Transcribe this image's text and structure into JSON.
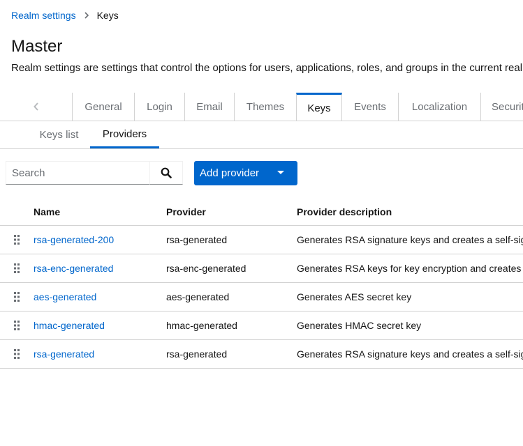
{
  "breadcrumb": {
    "parent": "Realm settings",
    "current": "Keys"
  },
  "page": {
    "title": "Master",
    "description": "Realm settings are settings that control the options for users, applications, roles, and groups in the current realm."
  },
  "tabs": [
    {
      "label": "General"
    },
    {
      "label": "Login"
    },
    {
      "label": "Email"
    },
    {
      "label": "Themes"
    },
    {
      "label": "Keys",
      "active": true
    },
    {
      "label": "Events"
    },
    {
      "label": "Localization"
    },
    {
      "label": "Security defenses"
    }
  ],
  "subtabs": [
    {
      "label": "Keys list"
    },
    {
      "label": "Providers",
      "active": true
    }
  ],
  "toolbar": {
    "search_placeholder": "Search",
    "add_provider_label": "Add provider"
  },
  "table": {
    "columns": [
      "Name",
      "Provider",
      "Provider description"
    ],
    "rows": [
      {
        "name": "rsa-generated-200",
        "provider": "rsa-generated",
        "description": "Generates RSA signature keys and creates a self-signed certificate"
      },
      {
        "name": "rsa-enc-generated",
        "provider": "rsa-enc-generated",
        "description": "Generates RSA keys for key encryption and creates a self-signed certificate"
      },
      {
        "name": "aes-generated",
        "provider": "aes-generated",
        "description": "Generates AES secret key"
      },
      {
        "name": "hmac-generated",
        "provider": "hmac-generated",
        "description": "Generates HMAC secret key"
      },
      {
        "name": "rsa-generated",
        "provider": "rsa-generated",
        "description": "Generates RSA signature keys and creates a self-signed certificate"
      }
    ]
  },
  "colors": {
    "link": "#0066cc",
    "primary_button": "#0066cc",
    "border": "#d2d2d2",
    "muted_text": "#6a6e73"
  },
  "icons": {
    "breadcrumb_separator": "chevron-right-icon",
    "tab_scroll": "chevron-left-icon",
    "search": "search-icon",
    "dropdown": "caret-down-icon",
    "row_handle": "drag-handle-icon"
  }
}
